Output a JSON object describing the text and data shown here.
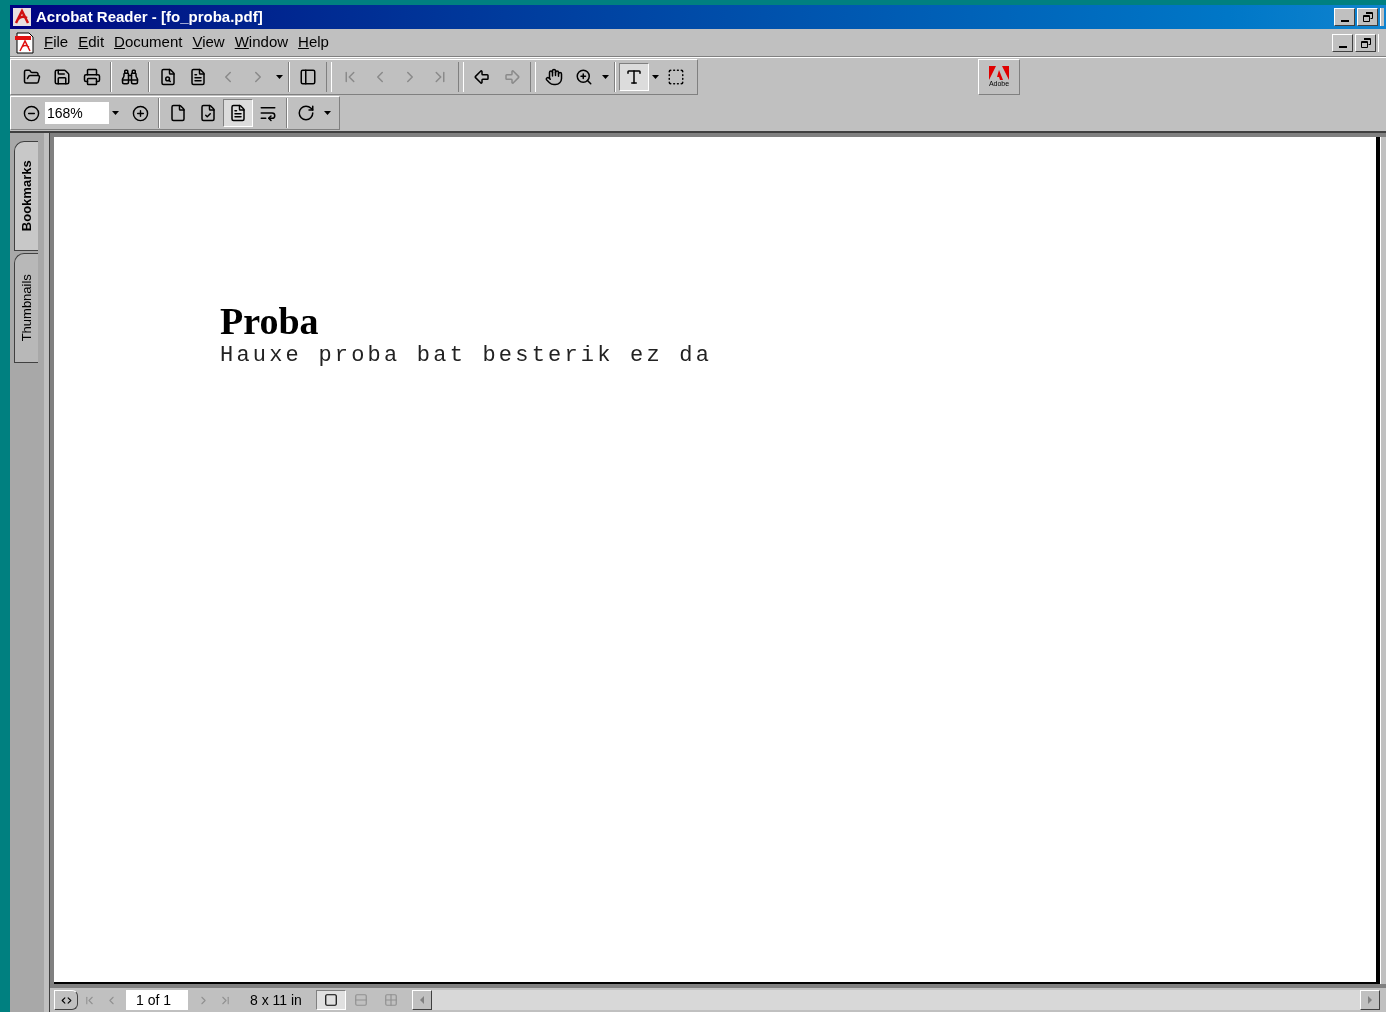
{
  "window": {
    "title": "Acrobat Reader - [fo_proba.pdf]"
  },
  "menu": [
    "File",
    "Edit",
    "Document",
    "View",
    "Window",
    "Help"
  ],
  "toolbar_top": [
    {
      "kind": "open",
      "disabled": false,
      "selected": false
    },
    {
      "kind": "save",
      "disabled": false,
      "selected": false
    },
    {
      "kind": "print",
      "disabled": false,
      "selected": false
    },
    {
      "kind": "sep"
    },
    {
      "kind": "find",
      "disabled": false,
      "selected": false
    },
    {
      "kind": "sep"
    },
    {
      "kind": "search",
      "disabled": false,
      "selected": false
    },
    {
      "kind": "index",
      "disabled": false,
      "selected": false
    },
    {
      "kind": "prev-result",
      "disabled": true,
      "selected": false
    },
    {
      "kind": "next-result",
      "disabled": true,
      "selected": false
    },
    {
      "kind": "dropdown"
    },
    {
      "kind": "sep"
    },
    {
      "kind": "panel",
      "disabled": false,
      "selected": false
    },
    {
      "kind": "gap"
    },
    {
      "kind": "first",
      "disabled": true,
      "selected": false
    },
    {
      "kind": "prev",
      "disabled": true,
      "selected": false
    },
    {
      "kind": "next",
      "disabled": true,
      "selected": false
    },
    {
      "kind": "last",
      "disabled": true,
      "selected": false
    },
    {
      "kind": "gap"
    },
    {
      "kind": "back",
      "disabled": false,
      "selected": false
    },
    {
      "kind": "forward",
      "disabled": true,
      "selected": false
    },
    {
      "kind": "gap"
    },
    {
      "kind": "hand",
      "disabled": false,
      "selected": false
    },
    {
      "kind": "zoom",
      "disabled": false,
      "selected": false
    },
    {
      "kind": "dropdown"
    },
    {
      "kind": "sep"
    },
    {
      "kind": "text-select",
      "disabled": false,
      "selected": true
    },
    {
      "kind": "dropdown"
    },
    {
      "kind": "graphics-select",
      "disabled": false,
      "selected": false
    }
  ],
  "logo": {
    "text": "Adobe"
  },
  "toolbar_bottom": {
    "zoom_value": "168%",
    "buttons": [
      {
        "kind": "actual-size",
        "disabled": false,
        "selected": false
      },
      {
        "kind": "fit-page",
        "disabled": false,
        "selected": false
      },
      {
        "kind": "fit-width",
        "disabled": false,
        "selected": true
      },
      {
        "kind": "reflow",
        "disabled": false,
        "selected": false
      },
      {
        "kind": "sep"
      },
      {
        "kind": "rotate",
        "disabled": false,
        "selected": false
      },
      {
        "kind": "dropdown"
      }
    ]
  },
  "side_tabs": [
    {
      "label": "Bookmarks",
      "selected": true
    },
    {
      "label": "Thumbnails",
      "selected": false
    }
  ],
  "document": {
    "heading": "Proba",
    "body": "Hauxe proba bat besterik ez da"
  },
  "status_bar": {
    "page": "1 of 1",
    "page_size": "8 x 11 in",
    "nav": [
      {
        "kind": "first",
        "disabled": true
      },
      {
        "kind": "prev",
        "disabled": true
      },
      {
        "kind": "page"
      },
      {
        "kind": "next",
        "disabled": true
      },
      {
        "kind": "last",
        "disabled": true
      }
    ],
    "layouts": [
      {
        "kind": "single",
        "selected": true
      },
      {
        "kind": "continuous",
        "selected": false
      },
      {
        "kind": "facing",
        "selected": false
      }
    ]
  }
}
